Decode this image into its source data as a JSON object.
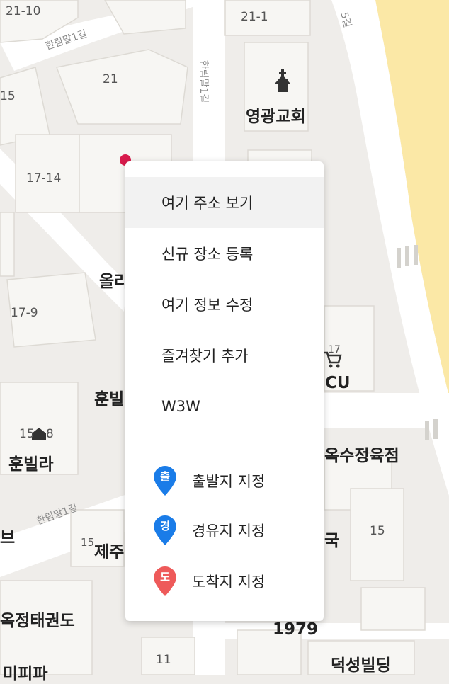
{
  "map": {
    "block_numbers": [
      "21-10",
      "21-1",
      "21",
      "15",
      "17-14",
      "17-9",
      "15",
      "8",
      "17",
      "15",
      "15",
      "11"
    ],
    "place_labels": [
      "영광교회",
      "올라",
      "훈빌",
      "훈빌라",
      "CU",
      "옥수정육점",
      "제주",
      "국",
      "옥정태권도",
      "1979",
      "덕성빌딩",
      "브",
      "미피파"
    ],
    "road_labels": [
      "한림말1길",
      "한림말1길",
      "한림말1길",
      "5길"
    ]
  },
  "menu": {
    "items": [
      {
        "label": "여기 주소 보기",
        "highlighted": true
      },
      {
        "label": "신규 장소 등록"
      },
      {
        "label": "여기 정보 수정"
      },
      {
        "label": "즐겨찾기 추가"
      },
      {
        "label": "W3W"
      }
    ],
    "route_items": [
      {
        "badge": "출",
        "label": "출발지 지정",
        "color": "#1a7ce8"
      },
      {
        "badge": "경",
        "label": "경유지 지정",
        "color": "#1a7ce8"
      },
      {
        "badge": "도",
        "label": "도착지 지정",
        "color": "#ee5a5a"
      }
    ]
  },
  "marker": {
    "color": "#d81b4c"
  }
}
